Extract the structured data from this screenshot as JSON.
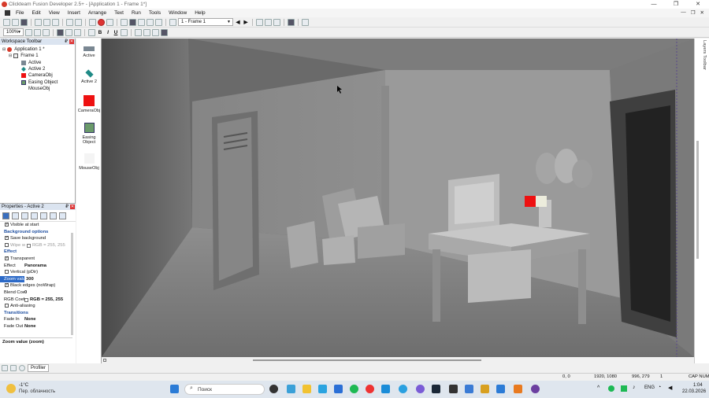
{
  "window": {
    "title": "Clickteam Fusion Developer 2.5+ - [Application 1 - Frame 1*]",
    "controls": [
      "—",
      "❐",
      "✕"
    ]
  },
  "menu": {
    "items": [
      "File",
      "Edit",
      "View",
      "Insert",
      "Arrange",
      "Text",
      "Run",
      "Tools",
      "Window",
      "Help"
    ],
    "right": [
      "—",
      "❐",
      "✕"
    ]
  },
  "toolbar": {
    "frame_select": "1 - Frame 1",
    "zoom_select": "100%",
    "bold": "B",
    "italic": "I",
    "underline": "U"
  },
  "workspace": {
    "title": "Workspace Toolbar",
    "pin": "₽",
    "close": "✕",
    "tree": [
      {
        "label": "Application 1 *",
        "indent": 0,
        "icon": "app-icon"
      },
      {
        "label": "Frame 1",
        "indent": 1,
        "icon": "frame-icon"
      },
      {
        "label": "Active",
        "indent": 2,
        "icon": "active-icon"
      },
      {
        "label": "Active 2",
        "indent": 2,
        "icon": "active2-icon"
      },
      {
        "label": "CameraObj",
        "indent": 2,
        "icon": "camera-icon"
      },
      {
        "label": "Easing Object",
        "indent": 2,
        "icon": "easing-icon"
      },
      {
        "label": "MouseObj",
        "indent": 2,
        "icon": "mouse-icon"
      }
    ]
  },
  "properties": {
    "title": "Properties - Active 2",
    "rows": [
      {
        "type": "check",
        "checked": true,
        "label": "Visible at start"
      },
      {
        "type": "section",
        "label": "Background options"
      },
      {
        "type": "check",
        "checked": true,
        "label": "Save background"
      },
      {
        "type": "checkval",
        "checked": false,
        "label": "Wipe w",
        "value": "RGB = 255, 255"
      },
      {
        "type": "section",
        "label": "Effect"
      },
      {
        "type": "check",
        "checked": true,
        "label": "Transparent"
      },
      {
        "type": "kv",
        "label": "Effect",
        "value": "Panorama"
      },
      {
        "type": "check",
        "checked": false,
        "label": "Vertical (pDir)"
      },
      {
        "type": "kv",
        "label": "Zoom valu",
        "value": "300",
        "highlight": true
      },
      {
        "type": "check",
        "checked": true,
        "label": "Black edges (noWrap)"
      },
      {
        "type": "kv",
        "label": "Blend Coef",
        "value": "0"
      },
      {
        "type": "kv",
        "label": "RGB Coeffi",
        "value": "RGB = 255, 255"
      },
      {
        "type": "check",
        "checked": false,
        "label": "Anti-aliasing"
      },
      {
        "type": "section",
        "label": "Transitions"
      },
      {
        "type": "kv",
        "label": "Fade In",
        "value": "None"
      },
      {
        "type": "kv",
        "label": "Fade Out",
        "value": "None"
      }
    ],
    "description": "Zoom value (zoom)"
  },
  "bottom_tabs": {
    "profiler": "Profiler"
  },
  "objects": [
    {
      "label": "Active",
      "color": "#7a8792"
    },
    {
      "label": "Active 2",
      "color": "#1f8a86"
    },
    {
      "label": "CameraObj",
      "color": "#ee1111"
    },
    {
      "label": "Easing Object",
      "color": "#6a9a6a"
    },
    {
      "label": "MouseObj",
      "color": "#f4f4f4"
    }
  ],
  "right_panel": {
    "title": "Layers Toolbar"
  },
  "status": {
    "cursor": "0, 0",
    "size": "1920, 1080",
    "pos": "996, 279",
    "frame": "1",
    "caps": "CAP  NUM"
  },
  "taskbar": {
    "weather_temp": "-1°C",
    "weather_desc": "Пер. облачность",
    "search": "Поиск",
    "lang": "ENG",
    "time": "1:04",
    "date": "22.03.2026"
  }
}
